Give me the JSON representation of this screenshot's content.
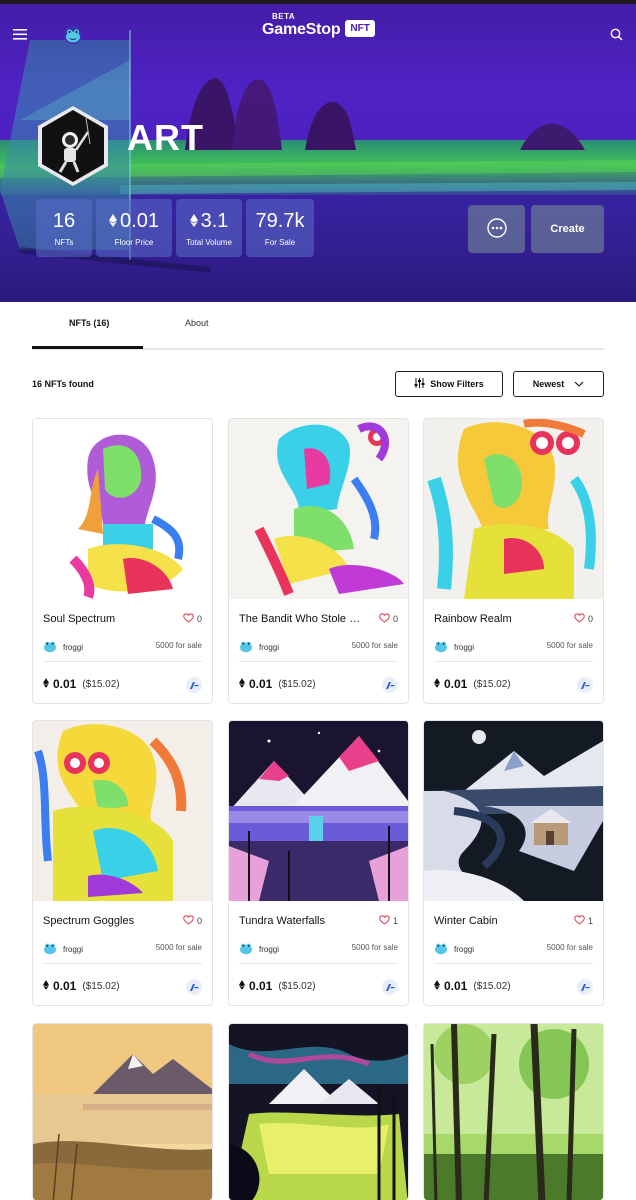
{
  "header": {
    "logo_beta": "BETA",
    "logo_word": "GameStop",
    "logo_badge": "NFT",
    "menu_icon": "hamburger-menu-icon",
    "avatar_icon": "frog-avatar-icon",
    "search_icon": "search-icon"
  },
  "collection": {
    "title": "ART",
    "stats": [
      {
        "value": "16",
        "label": "NFTs",
        "eth": false
      },
      {
        "value": "0.01",
        "label": "Floor Price",
        "eth": true
      },
      {
        "value": "3.1",
        "label": "Total Volume",
        "eth": true
      },
      {
        "value": "79.7k",
        "label": "For Sale",
        "eth": false
      }
    ],
    "more_icon": "more-dots-icon",
    "create_label": "Create"
  },
  "tabs": [
    {
      "label": "NFTs (16)",
      "active": true
    },
    {
      "label": "About",
      "active": false
    }
  ],
  "toolbar": {
    "found": "16 NFTs found",
    "filter_label": "Show Filters",
    "sort_label": "Newest"
  },
  "cards": [
    {
      "name": "Soul Spectrum",
      "likes": "0",
      "liked": false,
      "creator": "froggi",
      "supply": "5000 for sale",
      "price": "0.01",
      "usd": "($15.02)"
    },
    {
      "name": "The Bandit Who Stole M...",
      "likes": "0",
      "liked": false,
      "creator": "froggi",
      "supply": "5000 for sale",
      "price": "0.01",
      "usd": "($15.02)"
    },
    {
      "name": "Rainbow Realm",
      "likes": "0",
      "liked": false,
      "creator": "froggi",
      "supply": "5000 for sale",
      "price": "0.01",
      "usd": "($15.02)"
    },
    {
      "name": "Spectrum Goggles",
      "likes": "0",
      "liked": false,
      "creator": "froggi",
      "supply": "5000 for sale",
      "price": "0.01",
      "usd": "($15.02)"
    },
    {
      "name": "Tundra Waterfalls",
      "likes": "1",
      "liked": true,
      "creator": "froggi",
      "supply": "5000 for sale",
      "price": "0.01",
      "usd": "($15.02)"
    },
    {
      "name": "Winter Cabin",
      "likes": "1",
      "liked": true,
      "creator": "froggi",
      "supply": "5000 for sale",
      "price": "0.01",
      "usd": "($15.02)"
    }
  ],
  "colors": {
    "hero_purple": "#4a1fb8",
    "hero_green": "#23a55a",
    "heart_red": "#d9364a"
  }
}
